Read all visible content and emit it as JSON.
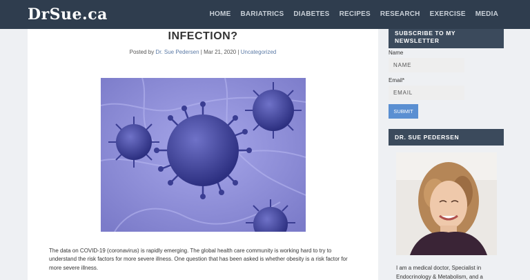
{
  "site": {
    "logo": "DrSue.ca"
  },
  "nav": {
    "items": [
      "HOME",
      "BARIATRICS",
      "DIABETES",
      "RECIPES",
      "RESEARCH",
      "EXERCISE",
      "MEDIA"
    ]
  },
  "post": {
    "title": "INFECTION?",
    "meta_prefix": "Posted by",
    "author": "Dr. Sue Pedersen",
    "sep1": " | ",
    "date": "Mar 21, 2020",
    "sep2": " | ",
    "category": "Uncategorized",
    "body": "The data on COVID-19 (coronavirus) is rapidly emerging.  The global health care community is working hard to try to understand the risk factors for more severe illness.   One question that has been asked is whether obesity is a risk factor for more severe illness."
  },
  "newsletter": {
    "heading": "SUBSCRIBE TO MY NEWSLETTER",
    "name_label": "Name",
    "name_placeholder": "NAME",
    "email_label": "Email*",
    "email_placeholder": "EMAIL",
    "submit_label": "SUBMIT"
  },
  "about": {
    "heading": "DR. SUE PEDERSEN",
    "text": "I am a medical doctor, Specialist in Endocrinology & Metabolism, and a"
  },
  "colors": {
    "topbar": "#2f3d4e",
    "widget_head": "#3b4a5c",
    "submit": "#5a8fd2",
    "link": "#5b7aa6",
    "hero": "#8e8ed8"
  }
}
